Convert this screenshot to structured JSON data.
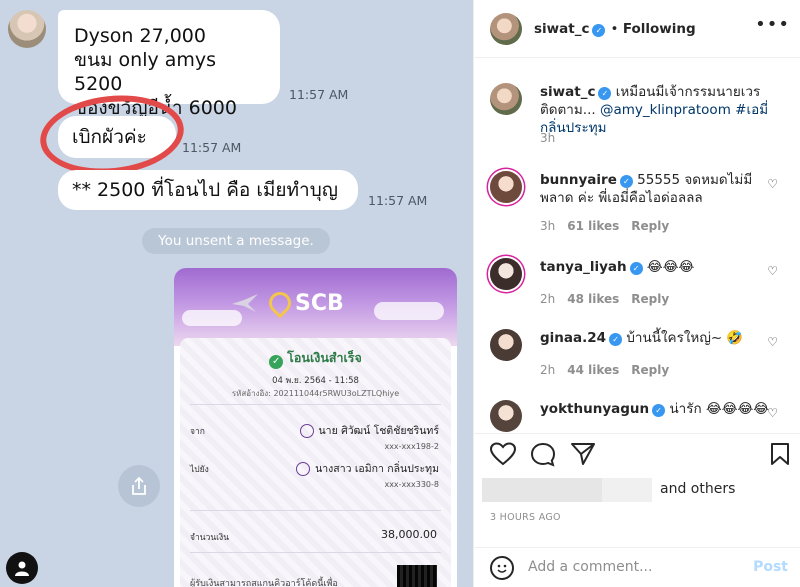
{
  "chat": {
    "bubble1_lines": [
      "Dyson 27,000",
      "ขนม only amys 5200",
      "ของขวัญอีน้ำ 6000"
    ],
    "bubble1_time": "11:57 AM",
    "bubble2": "เบิกผัวค่ะ",
    "bubble2_time": "11:57 AM",
    "bubble3": "** 2500 ที่โอนไป คือ เมียทำบุญ",
    "bubble3_time": "11:57 AM",
    "unsent": "You unsent a message.",
    "highlight_color": "#e24a4a"
  },
  "receipt": {
    "brand": "SCB",
    "title": "โอนเงินสำเร็จ",
    "date": "04 พ.ย. 2564 - 11:58",
    "ref_label": "รหัสอ้างอิง:",
    "ref_value": "202111044r5RWU3oLZTLQhiye",
    "from_label": "จาก",
    "from_name": "นาย ศิวัฒน์ โชติชัยชรินทร์",
    "from_account": "xxx-xxx198-2",
    "to_label": "ไปยัง",
    "to_name": "นางสาว เอมิกา กลิ่นประทุม",
    "to_account": "xxx-xxx330-8",
    "amount_label": "จำนวนเงิน",
    "amount": "38,000.00",
    "footer": "ผู้รับเงินสามารถสแกนคิวอาร์โค้ดนี้เพื่อ"
  },
  "instagram": {
    "accent": "#3897f0",
    "header": {
      "username": "siwat_c",
      "follow_state": "Following"
    },
    "caption": {
      "username": "siwat_c",
      "text": "เหมือนมีเจ้ากรรมนายเวรติดตาม...",
      "mention": "@amy_klinpratoom",
      "hashtag": "#เอมี่กลิ่นประทุม",
      "time": "3h"
    },
    "comments": [
      {
        "username": "bunnyaire",
        "text": "55555 จดหมดไม่มีพลาด ค่ะ พี่เอมี่คือไอด่อลลล",
        "time": "3h",
        "likes": "61 likes",
        "reply": "Reply"
      },
      {
        "username": "tanya_liyah",
        "text": "😂😂😂",
        "time": "2h",
        "likes": "48 likes",
        "reply": "Reply"
      },
      {
        "username": "ginaa.24",
        "text": "บ้านนี้ใครใหญ่~ 🤣",
        "time": "2h",
        "likes": "44 likes",
        "reply": "Reply"
      },
      {
        "username": "yokthunyagun",
        "text": "น่ารัก 😂😂😂😂",
        "time": "",
        "likes": "",
        "reply": ""
      }
    ],
    "likes_suffix": "and others",
    "time_ago": "3 HOURS AGO",
    "comment_placeholder": "Add a comment...",
    "post_label": "Post"
  }
}
